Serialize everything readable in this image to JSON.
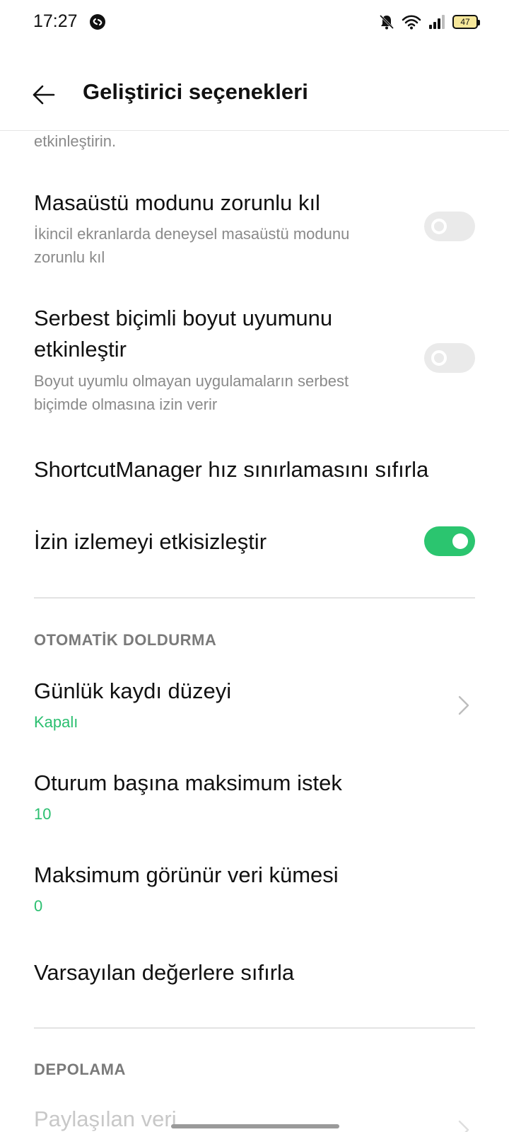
{
  "status_bar": {
    "time": "17:27",
    "battery": "47",
    "icons": [
      "shazam-icon",
      "mute-bell-icon",
      "wifi-icon",
      "signal-icon",
      "battery-icon"
    ]
  },
  "header": {
    "title": "Geliştirici seçenekleri",
    "back_icon": "arrow-left-icon"
  },
  "settings": {
    "partial_top_text": "etkinleştirin.",
    "desktop_mode": {
      "title": "Masaüstü modunu zorunlu kıl",
      "subtitle_line1": "İkincil ekranlarda deneysel masaüstü modunu",
      "subtitle_line2": "zorunlu kıl",
      "enabled": false
    },
    "freeform": {
      "title_line1": "Serbest biçimli boyut uyumunu",
      "title_line2": "etkinleştir",
      "subtitle_line1": "Boyut uyumlu olmayan uygulamaların serbest",
      "subtitle_line2": "biçimde olmasına izin verir",
      "enabled": false
    },
    "shortcut_reset": {
      "title": "ShortcutManager hız sınırlamasını sıfırla"
    },
    "permission_monitoring": {
      "title": "İzin izlemeyi etkisizleştir",
      "enabled": true
    }
  },
  "autofill": {
    "section_title": "OTOMATİK DOLDURMA",
    "log_level": {
      "title": "Günlük kaydı düzeyi",
      "value": "Kapalı"
    },
    "max_requests": {
      "title": "Oturum başına maksimum istek",
      "value": "10"
    },
    "max_datasets": {
      "title": "Maksimum görünür veri kümesi",
      "value": "0"
    },
    "reset_defaults": {
      "title": "Varsayılan değerlere sıfırla"
    }
  },
  "storage": {
    "section_title": "DEPOLAMA",
    "shared_data": {
      "title": "Paylaşılan veri"
    }
  },
  "colors": {
    "accent": "#2bc56f",
    "value_text": "#2bbf70",
    "toggle_off": "#eaeaea"
  }
}
